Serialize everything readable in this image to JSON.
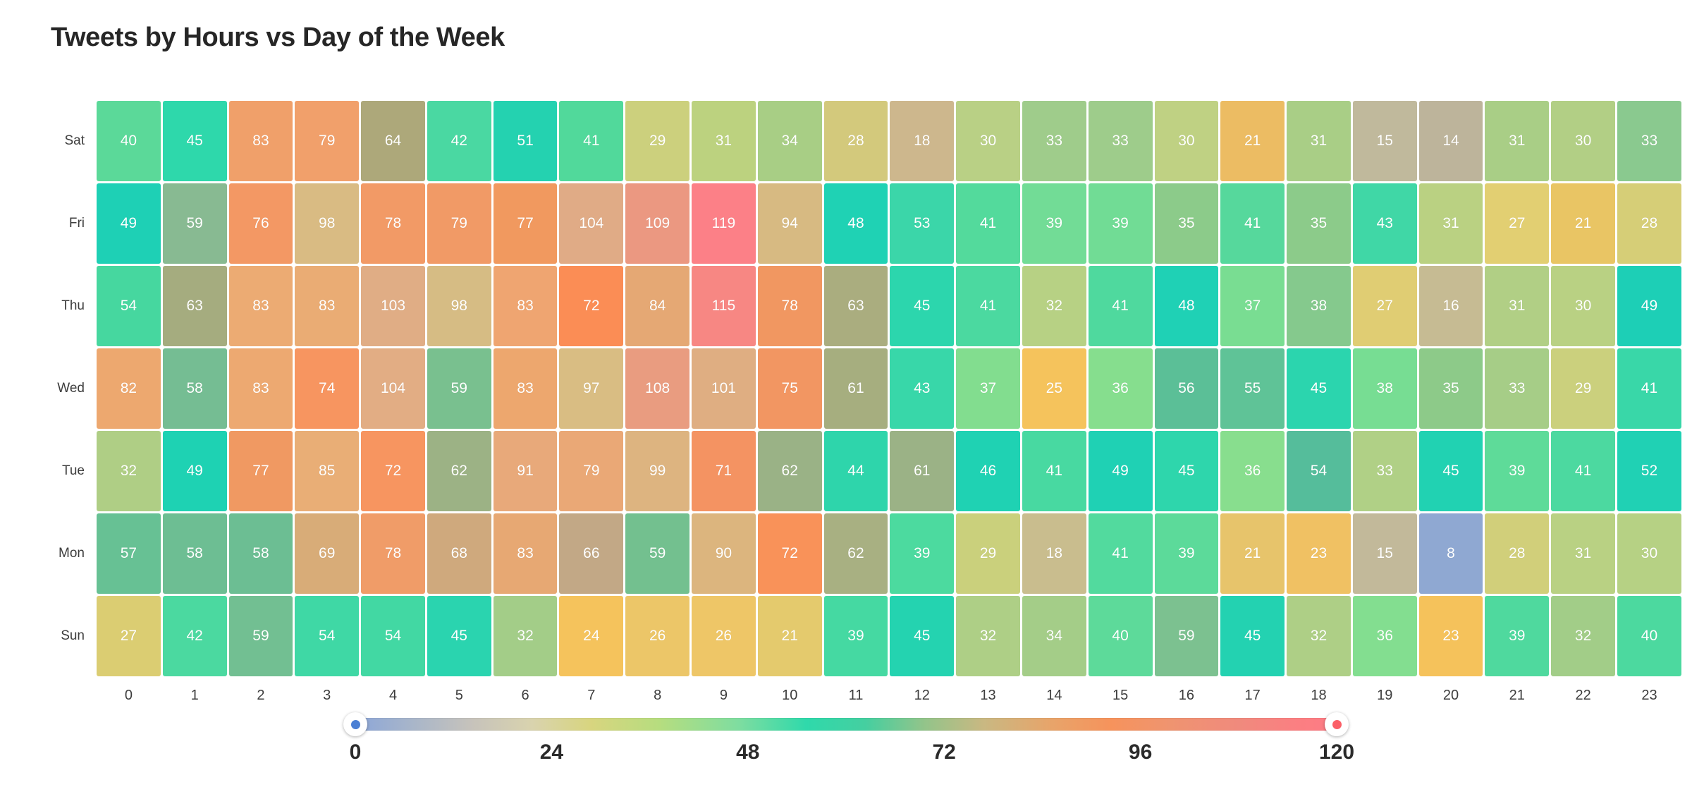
{
  "chart": {
    "title": "Tweets by Hours vs Day of the Week"
  },
  "legend": {
    "min_label": "0",
    "max_label": "120",
    "ticks": [
      "0",
      "24",
      "48",
      "72",
      "96",
      "120"
    ],
    "min_handle_color": "#4a7fd4",
    "max_handle_color": "#fb5f67"
  },
  "chart_data": {
    "type": "heatmap",
    "title": "Tweets by Hours vs Day of the Week",
    "xlabel": "",
    "ylabel": "",
    "legend_position": "bottom",
    "grid": false,
    "zmin": 0,
    "zmax": 120,
    "colorscale_ticks": [
      0,
      24,
      48,
      72,
      96,
      120
    ],
    "x": [
      "0",
      "1",
      "2",
      "3",
      "4",
      "5",
      "6",
      "7",
      "8",
      "9",
      "10",
      "11",
      "12",
      "13",
      "14",
      "15",
      "16",
      "17",
      "18",
      "19",
      "20",
      "21",
      "22",
      "23"
    ],
    "y": [
      "Sat",
      "Fri",
      "Thu",
      "Wed",
      "Tue",
      "Mon",
      "Sun"
    ],
    "rows": [
      {
        "label": "Sat",
        "values": [
          40,
          45,
          83,
          79,
          64,
          42,
          51,
          41,
          29,
          31,
          34,
          28,
          18,
          30,
          33,
          33,
          30,
          21,
          31,
          15,
          14,
          31,
          30,
          33
        ],
        "colors": [
          "#5bd999",
          "#2ed8ab",
          "#f0a06a",
          "#f1a06b",
          "#ada87a",
          "#4ad8a2",
          "#24d2b0",
          "#51d99b",
          "#ccd07d",
          "#bcd27f",
          "#a8ce85",
          "#d3c97c",
          "#cdb78d",
          "#b9d085",
          "#9fcc8b",
          "#9ecc8b",
          "#bfd183",
          "#ecbc63",
          "#a9ce86",
          "#c0b99c",
          "#bdb49b",
          "#a9ce86",
          "#b2cf85",
          "#8ac98f"
        ]
      },
      {
        "label": "Fri",
        "values": [
          49,
          59,
          76,
          98,
          78,
          79,
          77,
          104,
          109,
          119,
          94,
          48,
          53,
          41,
          39,
          39,
          35,
          41,
          35,
          43,
          31,
          27,
          21,
          28
        ],
        "colors": [
          "#1ed0b5",
          "#88ba92",
          "#f39864",
          "#d9bb83",
          "#f29a66",
          "#f19a66",
          "#f1995f",
          "#e0ab86",
          "#eb9881",
          "#fc8087",
          "#d7ba82",
          "#1fd2b4",
          "#3bd6a9",
          "#53da9c",
          "#72dc96",
          "#71dc95",
          "#8ccb8a",
          "#56d89c",
          "#8ccb8a",
          "#40d7a6",
          "#bad182",
          "#e2cf72",
          "#e9c564",
          "#d6ce77"
        ]
      },
      {
        "label": "Thu",
        "values": [
          54,
          63,
          83,
          83,
          103,
          98,
          83,
          72,
          84,
          115,
          78,
          63,
          45,
          41,
          32,
          41,
          48,
          37,
          38,
          27,
          16,
          31,
          30,
          49
        ],
        "colors": [
          "#46d79f",
          "#a5ac7f",
          "#ecab73",
          "#eaac74",
          "#e0ad85",
          "#d6bc84",
          "#efa571",
          "#fb8d55",
          "#e5a874",
          "#f78783",
          "#f19761",
          "#aaad7f",
          "#2cd6ad",
          "#4bd9a0",
          "#b7d184",
          "#4fd99e",
          "#1fd1b5",
          "#79dd92",
          "#85c98d",
          "#e0cd73",
          "#c6bb93",
          "#b1cf85",
          "#b9d183",
          "#1dcfb6"
        ]
      },
      {
        "label": "Wed",
        "values": [
          82,
          58,
          83,
          74,
          104,
          59,
          83,
          97,
          108,
          101,
          75,
          61,
          43,
          37,
          25,
          36,
          56,
          55,
          45,
          38,
          35,
          33,
          29,
          41
        ],
        "colors": [
          "#eda86f",
          "#75bd93",
          "#eda971",
          "#f79560",
          "#e2ad84",
          "#79c08f",
          "#eda76e",
          "#d9bd83",
          "#e99c80",
          "#dfae82",
          "#f29662",
          "#a6ae7f",
          "#38d7a9",
          "#82dd8f",
          "#f5c35c",
          "#86de8e",
          "#5bbf97",
          "#5fc397",
          "#2bd5ae",
          "#77dd93",
          "#8dca89",
          "#a6cd87",
          "#cbd07d",
          "#39d7a8"
        ]
      },
      {
        "label": "Tue",
        "values": [
          32,
          49,
          77,
          85,
          72,
          62,
          91,
          79,
          99,
          71,
          62,
          44,
          61,
          46,
          41,
          49,
          45,
          36,
          54,
          33,
          45,
          39,
          41,
          52
        ],
        "colors": [
          "#afce85",
          "#1ed2b3",
          "#f09962",
          "#e9ae76",
          "#f79560",
          "#9cb285",
          "#e8a97a",
          "#eaa876",
          "#ddb480",
          "#f49362",
          "#9ab286",
          "#2ed5ab",
          "#9bb286",
          "#1fd2b3",
          "#48d9a1",
          "#1fd1b4",
          "#2ed6ac",
          "#88de8e",
          "#55bd9b",
          "#b0d086",
          "#21d2b2",
          "#5edb99",
          "#4cd9a0",
          "#20d1b4"
        ]
      },
      {
        "label": "Mon",
        "values": [
          57,
          58,
          58,
          69,
          78,
          68,
          83,
          66,
          59,
          90,
          72,
          62,
          39,
          29,
          18,
          41,
          39,
          21,
          23,
          15,
          8,
          28,
          31,
          30
        ],
        "colors": [
          "#67c194",
          "#6dbe93",
          "#6cbe93",
          "#d8ac78",
          "#f09c68",
          "#cfa97d",
          "#e7a873",
          "#c2a886",
          "#73c08f",
          "#dcb57e",
          "#f99259",
          "#a8b082",
          "#4cda9f",
          "#cad07c",
          "#c9bd8e",
          "#52da9e",
          "#5cda9a",
          "#e7c46b",
          "#f0c163",
          "#c2b99a",
          "#8fa8d2",
          "#d1cf7a",
          "#b9d183",
          "#b6d184"
        ]
      },
      {
        "label": "Sun",
        "values": [
          27,
          42,
          59,
          54,
          54,
          45,
          32,
          24,
          26,
          26,
          21,
          39,
          45,
          32,
          34,
          40,
          59,
          45,
          32,
          36,
          23,
          39,
          32,
          40
        ],
        "colors": [
          "#dbcd72",
          "#4bd9a0",
          "#72bf92",
          "#3fd8a5",
          "#42d8a3",
          "#2ad4af",
          "#a3cd88",
          "#f5c35c",
          "#ecc668",
          "#eec667",
          "#e4ca6d",
          "#45d9a2",
          "#24d3b0",
          "#aecf86",
          "#a4cd88",
          "#5dda9a",
          "#7cc190",
          "#23d2b1",
          "#aecf86",
          "#83de90",
          "#f5c25b",
          "#4fd99e",
          "#a2cd88",
          "#4cd99f"
        ]
      }
    ]
  }
}
